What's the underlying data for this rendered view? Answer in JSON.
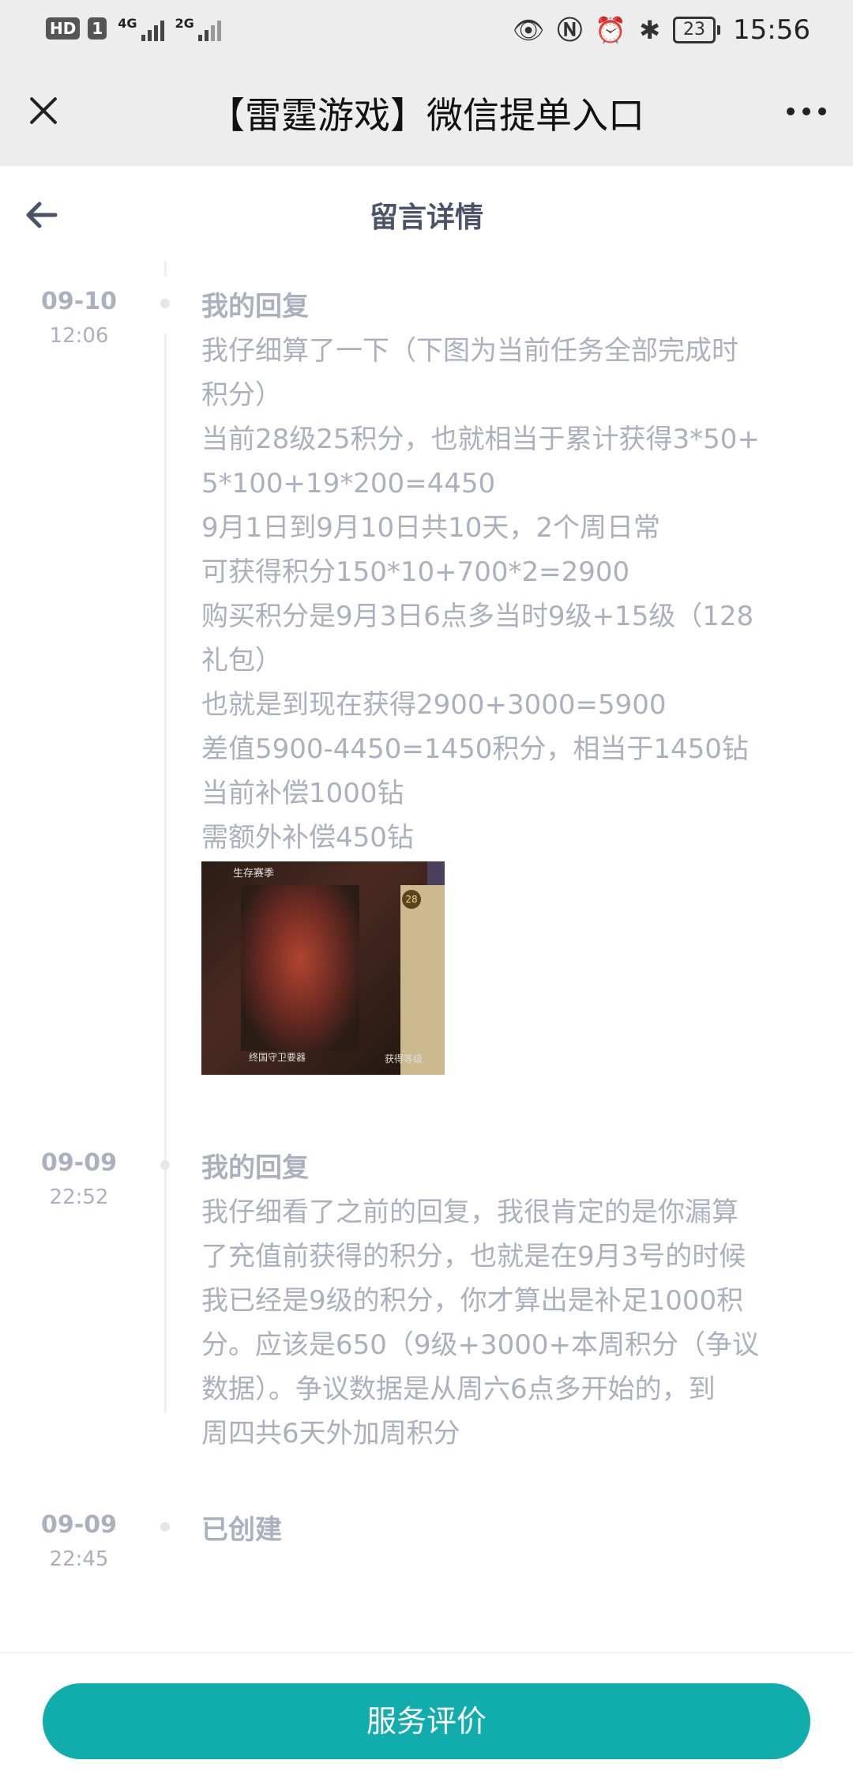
{
  "status_bar": {
    "hd": "HD",
    "sim": "1",
    "net1": "4G",
    "net2": "2G",
    "battery": "23",
    "time": "15:56"
  },
  "wechat": {
    "title": "【雷霆游戏】微信提单入口"
  },
  "page": {
    "title": "留言详情"
  },
  "entries": [
    {
      "date": "09-10",
      "time": "12:06",
      "title": "我的回复",
      "lines": [
        "我仔细算了一下（下图为当前任务全部完成时",
        "积分）",
        "当前28级25积分，也就相当于累计获得3*50+",
        "5*100+19*200=4450",
        "9月1日到9月10日共10天，2个周日常",
        "可获得积分150*10+700*2=2900",
        "购买积分是9月3日6点多当时9级+15级（128",
        "礼包）",
        "也就是到现在获得2900+3000=5900",
        "差值5900-4450=1450积分，相当于1450钻",
        "当前补偿1000钻",
        "需额外补偿450钻"
      ],
      "image": {
        "top_label": "生存赛季",
        "level": "28",
        "bottom_left": "终国守卫要器",
        "bottom_right": "获得等级"
      }
    },
    {
      "date": "09-09",
      "time": "22:52",
      "title": "我的回复",
      "lines": [
        "我仔细看了之前的回复，我很肯定的是你漏算",
        "了充值前获得的积分，也就是在9月3号的时候",
        "我已经是9级的积分，你才算出是补足1000积",
        "分。应该是650（9级+3000+本周积分（争议",
        "数据）。争议数据是从周六6点多开始的，到",
        "周四共6天外加周积分"
      ]
    },
    {
      "date": "09-09",
      "time": "22:45",
      "title": "已创建"
    }
  ],
  "footer": {
    "button": "服务评价"
  }
}
